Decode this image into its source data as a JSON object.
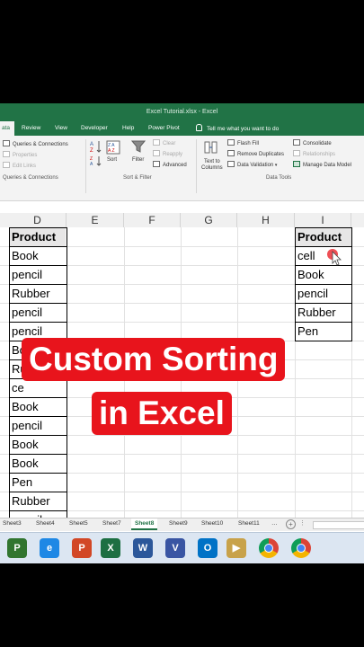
{
  "window": {
    "title": "Excel Tutorial.xlsx  -  Excel"
  },
  "ribbon_tabs": [
    "ata",
    "Review",
    "View",
    "Developer",
    "Help",
    "Power Pivot"
  ],
  "tell_me": "Tell me what you want to do",
  "ribbon": {
    "queries": [
      "Queries & Connections",
      "Properties",
      "Edit Links"
    ],
    "queries_group": "Queries & Connections",
    "sort_label": "Sort",
    "filter_label": "Filter",
    "filter_options": [
      "Clear",
      "Reapply",
      "Advanced"
    ],
    "sort_group": "Sort & Filter",
    "text_to_columns": [
      "Text to",
      "Columns"
    ],
    "data_tools_left": [
      "Flash Fill",
      "Remove Duplicates",
      "Data Validation"
    ],
    "data_tools_right": [
      "Consolidate",
      "Relationships",
      "Manage Data Model"
    ],
    "data_tools_group": "Data Tools"
  },
  "columns": [
    "D",
    "E",
    "F",
    "G",
    "H",
    "I"
  ],
  "column_d": [
    "Product",
    "Book",
    "pencil",
    "Rubber",
    "pencil",
    "pencil",
    "Bo",
    "Ru",
    "ce",
    "Book",
    "pencil",
    "Book",
    "Book",
    "Pen",
    "Rubber",
    "pencil"
  ],
  "column_i": [
    "Product",
    "cell",
    "Book",
    "pencil",
    "Rubber",
    "Pen"
  ],
  "sheets": [
    "Sheet3",
    "Sheet4",
    "Sheet5",
    "Sheet7",
    "Sheet8",
    "Sheet9",
    "Sheet10",
    "Sheet11"
  ],
  "active_sheet": "Sheet8",
  "taskbar": [
    {
      "icon": "project-icon",
      "letter": "P",
      "color": "#31752f"
    },
    {
      "icon": "internet-explorer-icon",
      "letter": "e",
      "color": "#1e88e5"
    },
    {
      "icon": "powerpoint-icon",
      "letter": "P",
      "color": "#d24726"
    },
    {
      "icon": "excel-icon",
      "letter": "X",
      "color": "#1d6f42"
    },
    {
      "icon": "word-icon",
      "letter": "W",
      "color": "#2b579a"
    },
    {
      "icon": "visio-icon",
      "letter": "V",
      "color": "#3955a3"
    },
    {
      "icon": "outlook-icon",
      "letter": "O",
      "color": "#0072c6"
    },
    {
      "icon": "media-player-icon",
      "letter": "▶",
      "color": "#c8a24a"
    },
    {
      "icon": "chrome-icon",
      "letter": "",
      "color": "#db4437"
    },
    {
      "icon": "chrome-alt-icon",
      "letter": "",
      "color": "#db4437"
    }
  ],
  "caption": {
    "line1": "Custom Sorting",
    "line2": "in Excel"
  },
  "colors": {
    "excel_green": "#217346",
    "caption_red": "#e8141c"
  }
}
